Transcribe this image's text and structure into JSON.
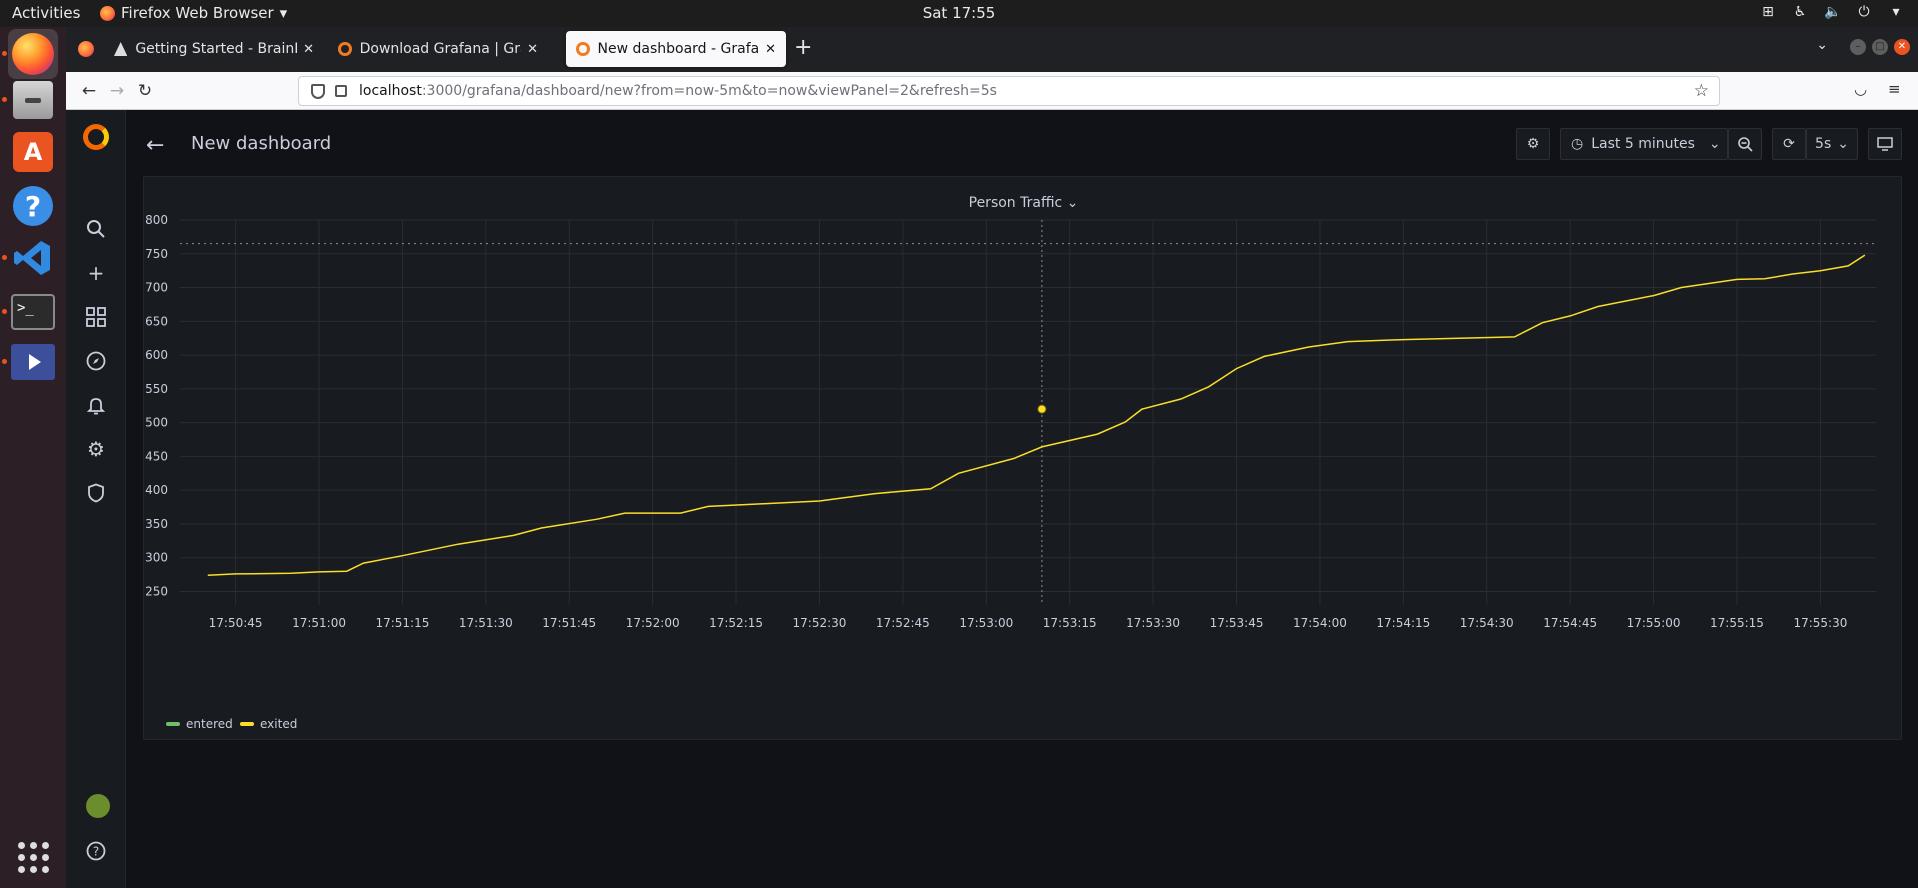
{
  "os": {
    "activities": "Activities",
    "app_name": "Firefox Web Browser",
    "clock": "Sat 17:55"
  },
  "browser": {
    "tabs": [
      {
        "title": "Getting Started - BrainFr",
        "favicon": "brainframe-icon"
      },
      {
        "title": "Download Grafana | Graf",
        "favicon": "grafana-icon"
      },
      {
        "title": "New dashboard - Grafana",
        "favicon": "grafana-icon",
        "active": true
      }
    ],
    "url_host": "localhost",
    "url_path": ":3000/grafana/dashboard/new?from=now-5m&to=now&viewPanel=2&refresh=5s"
  },
  "grafana": {
    "dashboard_title": "New dashboard",
    "time_range": "Last 5 minutes",
    "refresh_interval": "5s",
    "panel_title": "Person Traffic",
    "colors": {
      "entered": "#73bf69",
      "exited": "#fade2a"
    }
  },
  "chart_data": {
    "type": "line",
    "title": "Person Traffic",
    "ylim": [
      230,
      800
    ],
    "y_ticks": [
      800,
      750,
      700,
      650,
      600,
      550,
      500,
      450,
      400,
      350,
      300,
      250
    ],
    "x_ticks": [
      "17:50:45",
      "17:51:00",
      "17:51:15",
      "17:51:30",
      "17:51:45",
      "17:52:00",
      "17:52:15",
      "17:52:30",
      "17:52:45",
      "17:53:00",
      "17:53:15",
      "17:53:30",
      "17:53:45",
      "17:54:00",
      "17:54:15",
      "17:54:30",
      "17:54:45",
      "17:55:00",
      "17:55:15",
      "17:55:30"
    ],
    "x_start": "17:50:35",
    "x_end": "17:55:40",
    "threshold": 765,
    "hover": {
      "time": "17:53:10",
      "value": 520
    },
    "legend": [
      "entered",
      "exited"
    ],
    "series": [
      {
        "name": "exited",
        "color": "#fade2a",
        "points": [
          [
            "17:50:40",
            274
          ],
          [
            "17:50:45",
            276
          ],
          [
            "17:50:55",
            277
          ],
          [
            "17:51:00",
            279
          ],
          [
            "17:51:05",
            280
          ],
          [
            "17:51:08",
            292
          ],
          [
            "17:51:15",
            303
          ],
          [
            "17:51:25",
            320
          ],
          [
            "17:51:35",
            333
          ],
          [
            "17:51:40",
            344
          ],
          [
            "17:51:50",
            357
          ],
          [
            "17:51:55",
            366
          ],
          [
            "17:52:05",
            366
          ],
          [
            "17:52:10",
            376
          ],
          [
            "17:52:20",
            380
          ],
          [
            "17:52:30",
            384
          ],
          [
            "17:52:40",
            395
          ],
          [
            "17:52:50",
            402
          ],
          [
            "17:52:55",
            425
          ],
          [
            "17:53:05",
            447
          ],
          [
            "17:53:10",
            464
          ],
          [
            "17:53:20",
            483
          ],
          [
            "17:53:25",
            501
          ],
          [
            "17:53:28",
            520
          ],
          [
            "17:53:35",
            535
          ],
          [
            "17:53:40",
            553
          ],
          [
            "17:53:45",
            580
          ],
          [
            "17:53:50",
            598
          ],
          [
            "17:53:58",
            612
          ],
          [
            "17:54:05",
            620
          ],
          [
            "17:54:15",
            623
          ],
          [
            "17:54:25",
            625
          ],
          [
            "17:54:35",
            627
          ],
          [
            "17:54:40",
            648
          ],
          [
            "17:54:45",
            658
          ],
          [
            "17:54:50",
            672
          ],
          [
            "17:55:00",
            688
          ],
          [
            "17:55:05",
            700
          ],
          [
            "17:55:15",
            712
          ],
          [
            "17:55:20",
            713
          ],
          [
            "17:55:25",
            720
          ],
          [
            "17:55:30",
            725
          ],
          [
            "17:55:35",
            732
          ],
          [
            "17:55:38",
            748
          ]
        ]
      }
    ]
  }
}
